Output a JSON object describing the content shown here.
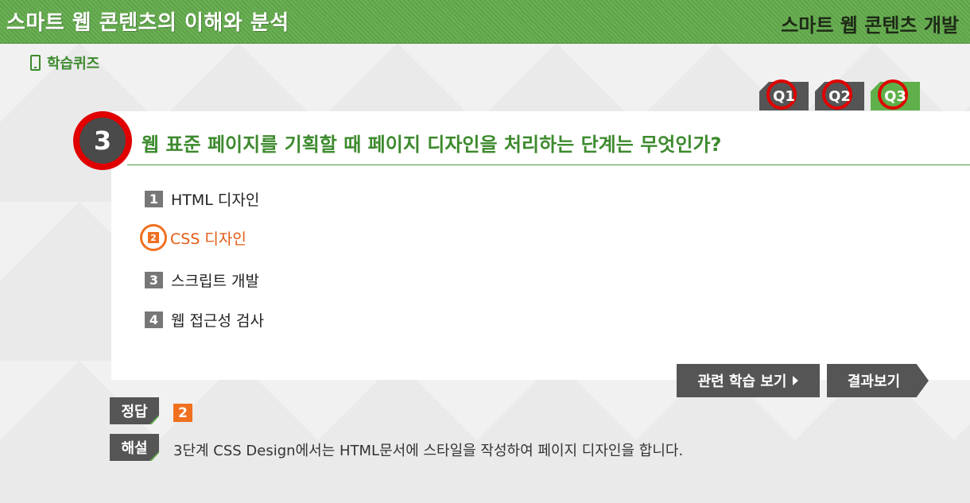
{
  "header": {
    "title": "스마트 웹 콘텐츠의 이해와 분석",
    "subtitle": "스마트 웹 콘텐츠 개발"
  },
  "section": {
    "label": "학습퀴즈"
  },
  "tabs": [
    {
      "label": "Q1",
      "active": false
    },
    {
      "label": "Q2",
      "active": false
    },
    {
      "label": "Q3",
      "active": true
    }
  ],
  "question": {
    "number": "3",
    "text": "웹 표준 페이지를 기획할 때 페이지 디자인을 처리하는 단계는 무엇인가?"
  },
  "options": [
    {
      "num": "1",
      "text": "HTML 디자인",
      "selected": false
    },
    {
      "num": "2",
      "text": "CSS 디자인",
      "selected": true
    },
    {
      "num": "3",
      "text": "스크립트 개발",
      "selected": false
    },
    {
      "num": "4",
      "text": "웹 접근성 검사",
      "selected": false
    }
  ],
  "buttons": {
    "related": "관련 학습 보기",
    "result": "결과보기"
  },
  "answer": {
    "label": "정답",
    "value": "2"
  },
  "explanation": {
    "label": "해설",
    "text": "3단계 CSS Design에서는 HTML문서에 스타일을 작성하여 페이지 디자인을 합니다."
  },
  "colors": {
    "header_green": "#5ea34a",
    "accent_green": "#3d8a2e",
    "highlight_red": "#e00000",
    "selected_orange": "#f07020"
  }
}
